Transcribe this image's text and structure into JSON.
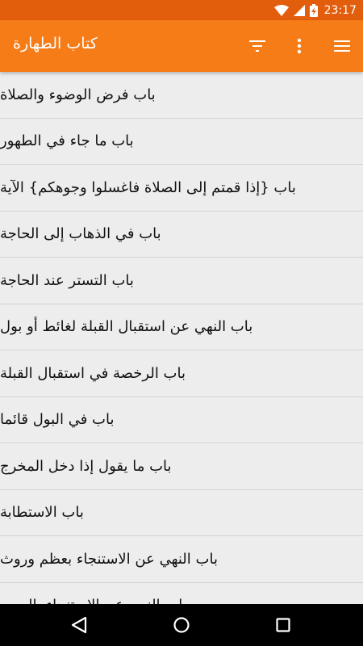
{
  "status_bar": {
    "time": "23:17",
    "icons": [
      "wifi-icon",
      "signal-icon",
      "battery-charging-icon"
    ]
  },
  "app_bar": {
    "title": "كتاب الطهارة",
    "icons": [
      "filter-icon",
      "more-vert-icon",
      "menu-icon"
    ]
  },
  "list": {
    "items": [
      "باب فرض الوضوء والصلاة",
      "باب ما جاء في الطهور",
      "باب {إذا قمتم إلى الصلاة فاغسلوا وجوهكم} الآية",
      "باب في الذهاب إلى الحاجة",
      "باب التستر عند الحاجة",
      "باب النهي عن استقبال القبلة لغائط أو بول",
      "باب الرخصة في استقبال القبلة",
      "باب في البول قائما",
      "باب ما يقول إذا دخل المخرج",
      "باب الاستطابة",
      "باب النهي عن الاستنجاء بعظم وروث",
      "باب النهي عن الاستنجاء باليمين"
    ]
  },
  "nav_bar": {
    "icons": [
      "back-icon",
      "home-icon",
      "recent-apps-icon"
    ]
  },
  "colors": {
    "status_bar": "#e35e0c",
    "app_bar": "#f57c16",
    "list_background": "#ededed",
    "divider": "#d3d3d3",
    "nav_bar": "#000000"
  }
}
